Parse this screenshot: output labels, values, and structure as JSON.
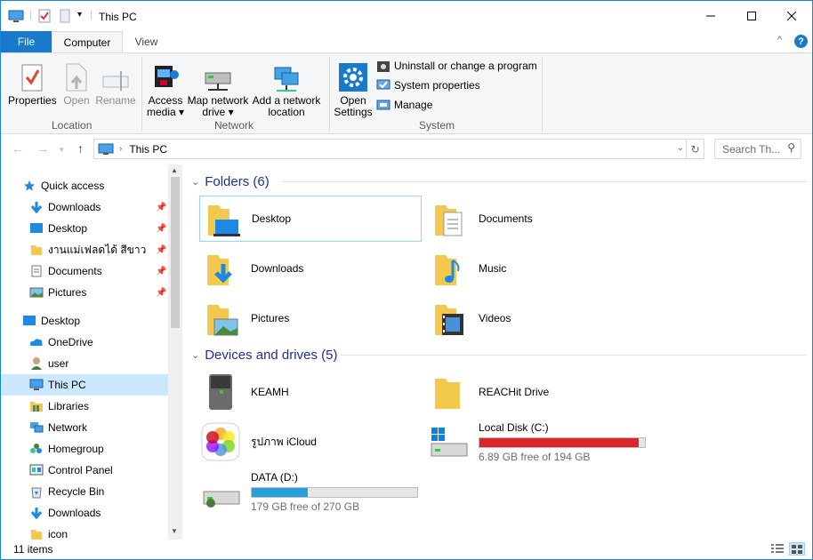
{
  "window": {
    "title": "This PC"
  },
  "tabs": {
    "file": "File",
    "computer": "Computer",
    "view": "View"
  },
  "ribbon": {
    "location": {
      "properties": "Properties",
      "open": "Open",
      "rename": "Rename",
      "group": "Location"
    },
    "network": {
      "access_media_1": "Access",
      "access_media_2": "media",
      "map_drive_1": "Map network",
      "map_drive_2": "drive",
      "add_location_1": "Add a network",
      "add_location_2": "location",
      "group": "Network"
    },
    "system": {
      "open_settings_1": "Open",
      "open_settings_2": "Settings",
      "uninstall": "Uninstall or change a program",
      "sysprops": "System properties",
      "manage": "Manage",
      "group": "System"
    }
  },
  "nav": {
    "address": "This PC",
    "search_placeholder": "Search Th..."
  },
  "sidebar": {
    "items": [
      {
        "label": "Quick access",
        "icon": "star-icon"
      },
      {
        "label": "Downloads",
        "icon": "download-icon",
        "pinned": true
      },
      {
        "label": "Desktop",
        "icon": "desktop-icon",
        "pinned": true
      },
      {
        "label": "งานแม่เฟลดได้ สีขาว",
        "icon": "folder-icon",
        "pinned": true
      },
      {
        "label": "Documents",
        "icon": "document-icon",
        "pinned": true
      },
      {
        "label": "Pictures",
        "icon": "pictures-icon",
        "pinned": true
      },
      {
        "label": "Desktop",
        "icon": "desktop-icon"
      },
      {
        "label": "OneDrive",
        "icon": "cloud-icon"
      },
      {
        "label": "user",
        "icon": "user-icon"
      },
      {
        "label": "This PC",
        "icon": "computer-icon",
        "selected": true
      },
      {
        "label": "Libraries",
        "icon": "libraries-icon"
      },
      {
        "label": "Network",
        "icon": "network-icon"
      },
      {
        "label": "Homegroup",
        "icon": "homegroup-icon"
      },
      {
        "label": "Control Panel",
        "icon": "control-panel-icon"
      },
      {
        "label": "Recycle Bin",
        "icon": "recycle-bin-icon"
      },
      {
        "label": "Downloads",
        "icon": "download-icon"
      },
      {
        "label": "icon",
        "icon": "folder-icon"
      }
    ]
  },
  "folders": {
    "header": "Folders (6)",
    "items": [
      {
        "label": "Desktop"
      },
      {
        "label": "Documents"
      },
      {
        "label": "Downloads"
      },
      {
        "label": "Music"
      },
      {
        "label": "Pictures"
      },
      {
        "label": "Videos"
      }
    ]
  },
  "devices": {
    "header": "Devices and drives (5)",
    "keamh": "KEAMH",
    "reachit": "REACHit Drive",
    "icloud": "รูปภาพ iCloud",
    "localc": {
      "label": "Local Disk (C:)",
      "free": "6.89 GB free of 194 GB",
      "used_fraction": 0.964,
      "color": "#da2626"
    },
    "datad": {
      "label": "DATA (D:)",
      "free": "179 GB free of 270 GB",
      "used_fraction": 0.337,
      "color": "#26a0da"
    }
  },
  "status": {
    "items": "11 items"
  }
}
